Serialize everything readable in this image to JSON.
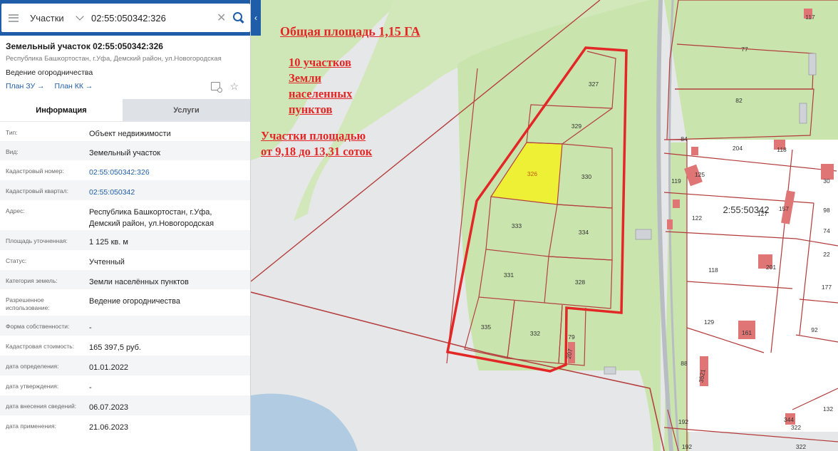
{
  "search": {
    "type": "Участки",
    "value": "02:55:050342:326"
  },
  "object": {
    "title": "Земельный участок 02:55:050342:326",
    "address": "Республика Башкортостан, г.Уфа, Демский район, ул.Новогородская",
    "usage": "Ведение огородничества",
    "plan_zu": "План ЗУ",
    "plan_kk": "План КК"
  },
  "tabs": {
    "info": "Информация",
    "services": "Услуги"
  },
  "properties": [
    {
      "label": "Тип:",
      "value": "Объект недвижимости"
    },
    {
      "label": "Вид:",
      "value": "Земельный участок"
    },
    {
      "label": "Кадастровый номер:",
      "value": "02:55:050342:326",
      "link": true
    },
    {
      "label": "Кадастровый квартал:",
      "value": "02:55:050342",
      "link": true
    },
    {
      "label": "Адрес:",
      "value": "Республика Башкортостан, г.Уфа, Демский район, ул.Новогородская"
    },
    {
      "label": "Площадь уточненная:",
      "value": "1 125 кв. м"
    },
    {
      "label": "Статус:",
      "value": "Учтенный"
    },
    {
      "label": "Категория земель:",
      "value": "Земли населённых пунктов"
    },
    {
      "label": "Разрешенное использование:",
      "value": "Ведение огородничества"
    },
    {
      "label": "Форма собственности:",
      "value": "-"
    },
    {
      "label": "Кадастровая стоимость:",
      "value": "165 397,5 руб."
    },
    {
      "label": "дата определения:",
      "value": "01.01.2022"
    },
    {
      "label": "дата утверждения:",
      "value": "-"
    },
    {
      "label": "дата внесения сведений:",
      "value": "06.07.2023"
    },
    {
      "label": "дата применения:",
      "value": "21.06.2023"
    }
  ],
  "annotations": {
    "total_area": "Общая площадь 1,15 ГА",
    "plots_line1": "10 участков",
    "plots_line2": "Земли",
    "plots_line3": "населенных",
    "plots_line4": "пунктов",
    "size_line1": "Участки площадью",
    "size_line2": "от 9,18  до 13,31 соток"
  },
  "map": {
    "plots": [
      "327",
      "329",
      "326",
      "330",
      "333",
      "334",
      "331",
      "328",
      "335",
      "332",
      "79",
      "207"
    ],
    "neighbor_labels": [
      "117",
      "77",
      "82",
      "84",
      "204",
      "118",
      "119",
      "125",
      "127",
      "157",
      "122",
      "2:55:50342",
      "30",
      "98",
      "74",
      "22",
      "118",
      "201",
      "177",
      "129",
      "161",
      "92",
      "88",
      "3521",
      "192",
      "344",
      "322",
      "132",
      "192",
      "322"
    ],
    "colors": {
      "green": "#c9e4ad",
      "highlight": "#eef036",
      "boundary": "#e32626",
      "parcel_line": "#b33a3a",
      "building": "#e07575",
      "water": "#b0cbe2"
    }
  }
}
